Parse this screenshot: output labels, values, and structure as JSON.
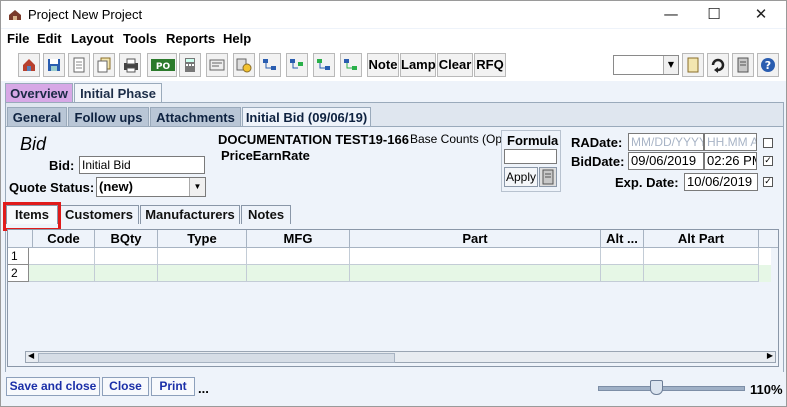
{
  "window": {
    "title": "Project New Project",
    "minimize": "—",
    "maximize": "☐",
    "close": "✕"
  },
  "menu": [
    "File",
    "Edit",
    "Layout",
    "Tools",
    "Reports",
    "Help"
  ],
  "toolbar": {
    "icons": [
      "company-icon",
      "save-icon",
      "document-icon",
      "copy-document-icon",
      "print-icon",
      "po-icon",
      "calculator-icon",
      "card-icon",
      "tree-icon",
      "flow-icon",
      "flow2-icon",
      "flow3-icon",
      "flow4-icon"
    ],
    "po_label": "PO",
    "text_buttons": [
      "Note",
      "Lamp",
      "Clear",
      "RFQ"
    ]
  },
  "primary_tabs": [
    "Overview",
    "Initial Phase"
  ],
  "secondary_tabs": [
    "General",
    "Follow ups",
    "Attachments",
    "Initial Bid (09/06/19)"
  ],
  "bid": {
    "heading": "Bid",
    "bid_label": "Bid:",
    "bid_value": "Initial Bid",
    "quote_status_label": "Quote Status:",
    "quote_status_value": "(new)",
    "doc_title": "DOCUMENTATION TEST19-166",
    "base_counts": "Base Counts (Opt",
    "price_earn_rate": "PriceEarnRate",
    "formula_label": "Formula",
    "apply_label": "Apply"
  },
  "dates": {
    "radate_label": "RADate:",
    "radate_placeholder": "MM/DD/YYYY",
    "radate_time_placeholder": "HH.MM A",
    "biddate_label": "BidDate:",
    "biddate_value": "09/06/2019",
    "biddate_time": "02:26 PM",
    "expdate_label": "Exp. Date:",
    "expdate_value": "10/06/2019",
    "checkmark": "✓"
  },
  "item_tabs": [
    "Items",
    "Customers",
    "Manufacturers",
    "Notes"
  ],
  "table": {
    "columns": [
      "Code",
      "BQty",
      "Type",
      "MFG",
      "Part",
      "Alt ...",
      "Alt Part"
    ],
    "rows": [
      {
        "num": "1",
        "cells": [
          "",
          "",
          "",
          "",
          "",
          "",
          ""
        ]
      },
      {
        "num": "2",
        "cells": [
          "",
          "",
          "",
          "",
          "",
          "",
          ""
        ]
      }
    ]
  },
  "bottom": {
    "save_close": "Save and close",
    "close": "Close",
    "print": "Print",
    "ellipsis": "...",
    "zoom": "110%"
  },
  "colors": {
    "highlight": "#e01b1b",
    "overview_tab": "#d7a8e6",
    "row_alt": "#e6f7e6"
  }
}
